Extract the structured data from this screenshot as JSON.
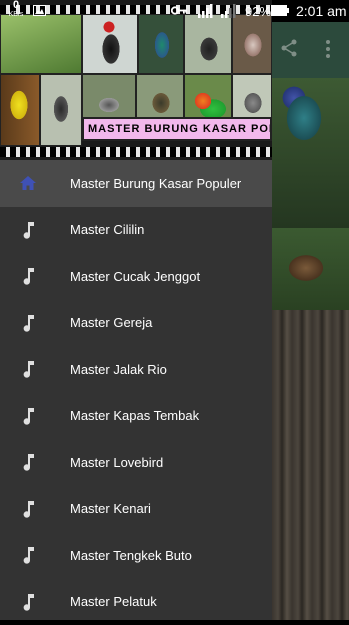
{
  "status_bar": {
    "net_speed": "0",
    "net_unit": "KB/s",
    "battery_percent": "92%",
    "time": "2:01 am"
  },
  "drawer": {
    "banner_text": "MASTER BURUNG KASAR POPULER",
    "items": [
      {
        "label": "Master Burung Kasar Populer",
        "icon": "home-icon"
      },
      {
        "label": "Master Cililin",
        "icon": "music-note-icon"
      },
      {
        "label": "Master Cucak Jenggot",
        "icon": "music-note-icon"
      },
      {
        "label": "Master Gereja",
        "icon": "music-note-icon"
      },
      {
        "label": "Master Jalak Rio",
        "icon": "music-note-icon"
      },
      {
        "label": "Master Kapas Tembak",
        "icon": "music-note-icon"
      },
      {
        "label": "Master Lovebird",
        "icon": "music-note-icon"
      },
      {
        "label": "Master Kenari",
        "icon": "music-note-icon"
      },
      {
        "label": "Master Tengkek Buto",
        "icon": "music-note-icon"
      },
      {
        "label": "Master Pelatuk",
        "icon": "music-note-icon"
      }
    ]
  },
  "colors": {
    "drawer_bg": "#333333",
    "active_item_bg": "#4a4a4a",
    "home_icon": "#3f51b5",
    "note_icon": "#e0e0e0",
    "banner_bg": "#f2b8ec",
    "appbar_bg": "#2c4a3c"
  }
}
